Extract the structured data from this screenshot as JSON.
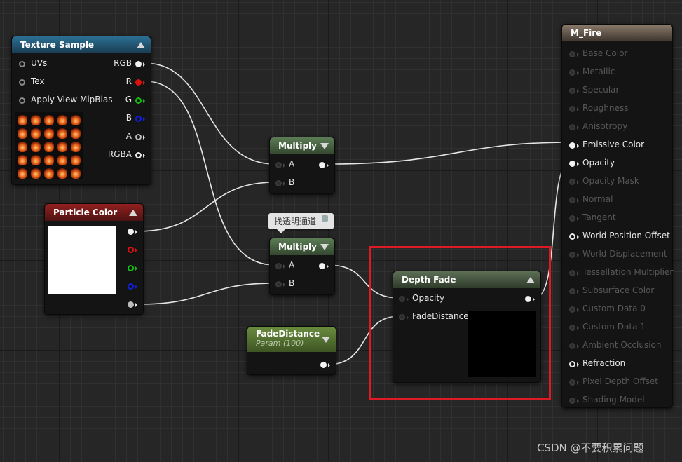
{
  "nodes": {
    "texture_sample": {
      "title": "Texture Sample",
      "inputs": [
        "UVs",
        "Tex",
        "Apply View MipBias"
      ],
      "outputs": [
        "RGB",
        "R",
        "G",
        "B",
        "A",
        "RGBA"
      ]
    },
    "particle_color": {
      "title": "Particle Color"
    },
    "multiply_1": {
      "title": "Multiply",
      "inputs": [
        "A",
        "B"
      ]
    },
    "multiply_2": {
      "title": "Multiply",
      "inputs": [
        "A",
        "B"
      ]
    },
    "fade_distance": {
      "title": "FadeDistance",
      "subtitle": "Param (100)"
    },
    "depth_fade": {
      "title": "Depth Fade",
      "inputs": [
        "Opacity",
        "FadeDistance"
      ]
    },
    "material": {
      "title": "M_Fire",
      "pins": [
        {
          "label": "Base Color",
          "active": false
        },
        {
          "label": "Metallic",
          "active": false
        },
        {
          "label": "Specular",
          "active": false
        },
        {
          "label": "Roughness",
          "active": false
        },
        {
          "label": "Anisotropy",
          "active": false
        },
        {
          "label": "Emissive Color",
          "active": true,
          "connected": true
        },
        {
          "label": "Opacity",
          "active": true,
          "connected": true
        },
        {
          "label": "Opacity Mask",
          "active": false
        },
        {
          "label": "Normal",
          "active": false
        },
        {
          "label": "Tangent",
          "active": false
        },
        {
          "label": "World Position Offset",
          "active": true,
          "connected": false
        },
        {
          "label": "World Displacement",
          "active": false
        },
        {
          "label": "Tessellation Multiplier",
          "active": false
        },
        {
          "label": "Subsurface Color",
          "active": false
        },
        {
          "label": "Custom Data 0",
          "active": false
        },
        {
          "label": "Custom Data 1",
          "active": false
        },
        {
          "label": "Ambient Occlusion",
          "active": false
        },
        {
          "label": "Refraction",
          "active": true,
          "connected": false
        },
        {
          "label": "Pixel Depth Offset",
          "active": false
        },
        {
          "label": "Shading Model",
          "active": false
        }
      ]
    }
  },
  "tooltip": {
    "text": "找透明通道"
  },
  "watermark": {
    "text": "CSDN @不要积累问题"
  },
  "colors": {
    "canvas": "#262626",
    "highlight": "#e01a24",
    "pin_red": "#e01010",
    "pin_green": "#10c010",
    "pin_blue": "#1020e0"
  }
}
